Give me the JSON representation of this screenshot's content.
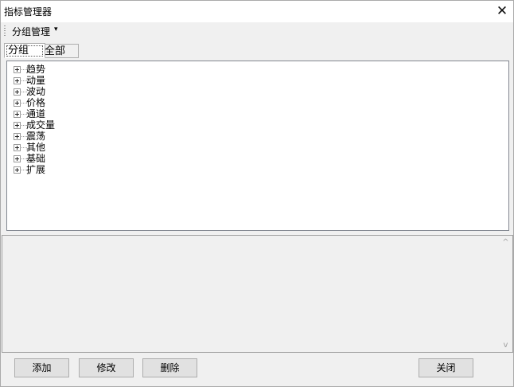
{
  "window": {
    "title": "指标管理器",
    "close_glyph": "✕"
  },
  "toolbar": {
    "menu_label": "分组管理",
    "caret": "▾"
  },
  "tabs": [
    {
      "label": "分组",
      "active": true
    },
    {
      "label": "全部",
      "active": false
    }
  ],
  "tree": {
    "items": [
      {
        "label": "趋势"
      },
      {
        "label": "动量"
      },
      {
        "label": "波动"
      },
      {
        "label": "价格"
      },
      {
        "label": "通道"
      },
      {
        "label": "成交量"
      },
      {
        "label": "震荡"
      },
      {
        "label": "其他"
      },
      {
        "label": "基础"
      },
      {
        "label": "扩展"
      }
    ]
  },
  "description_panel": {
    "text": ""
  },
  "scrollbar": {
    "up_glyph": "^",
    "down_glyph": "v"
  },
  "buttons": {
    "add": "添加",
    "edit": "修改",
    "delete": "删除",
    "close": "关闭"
  }
}
